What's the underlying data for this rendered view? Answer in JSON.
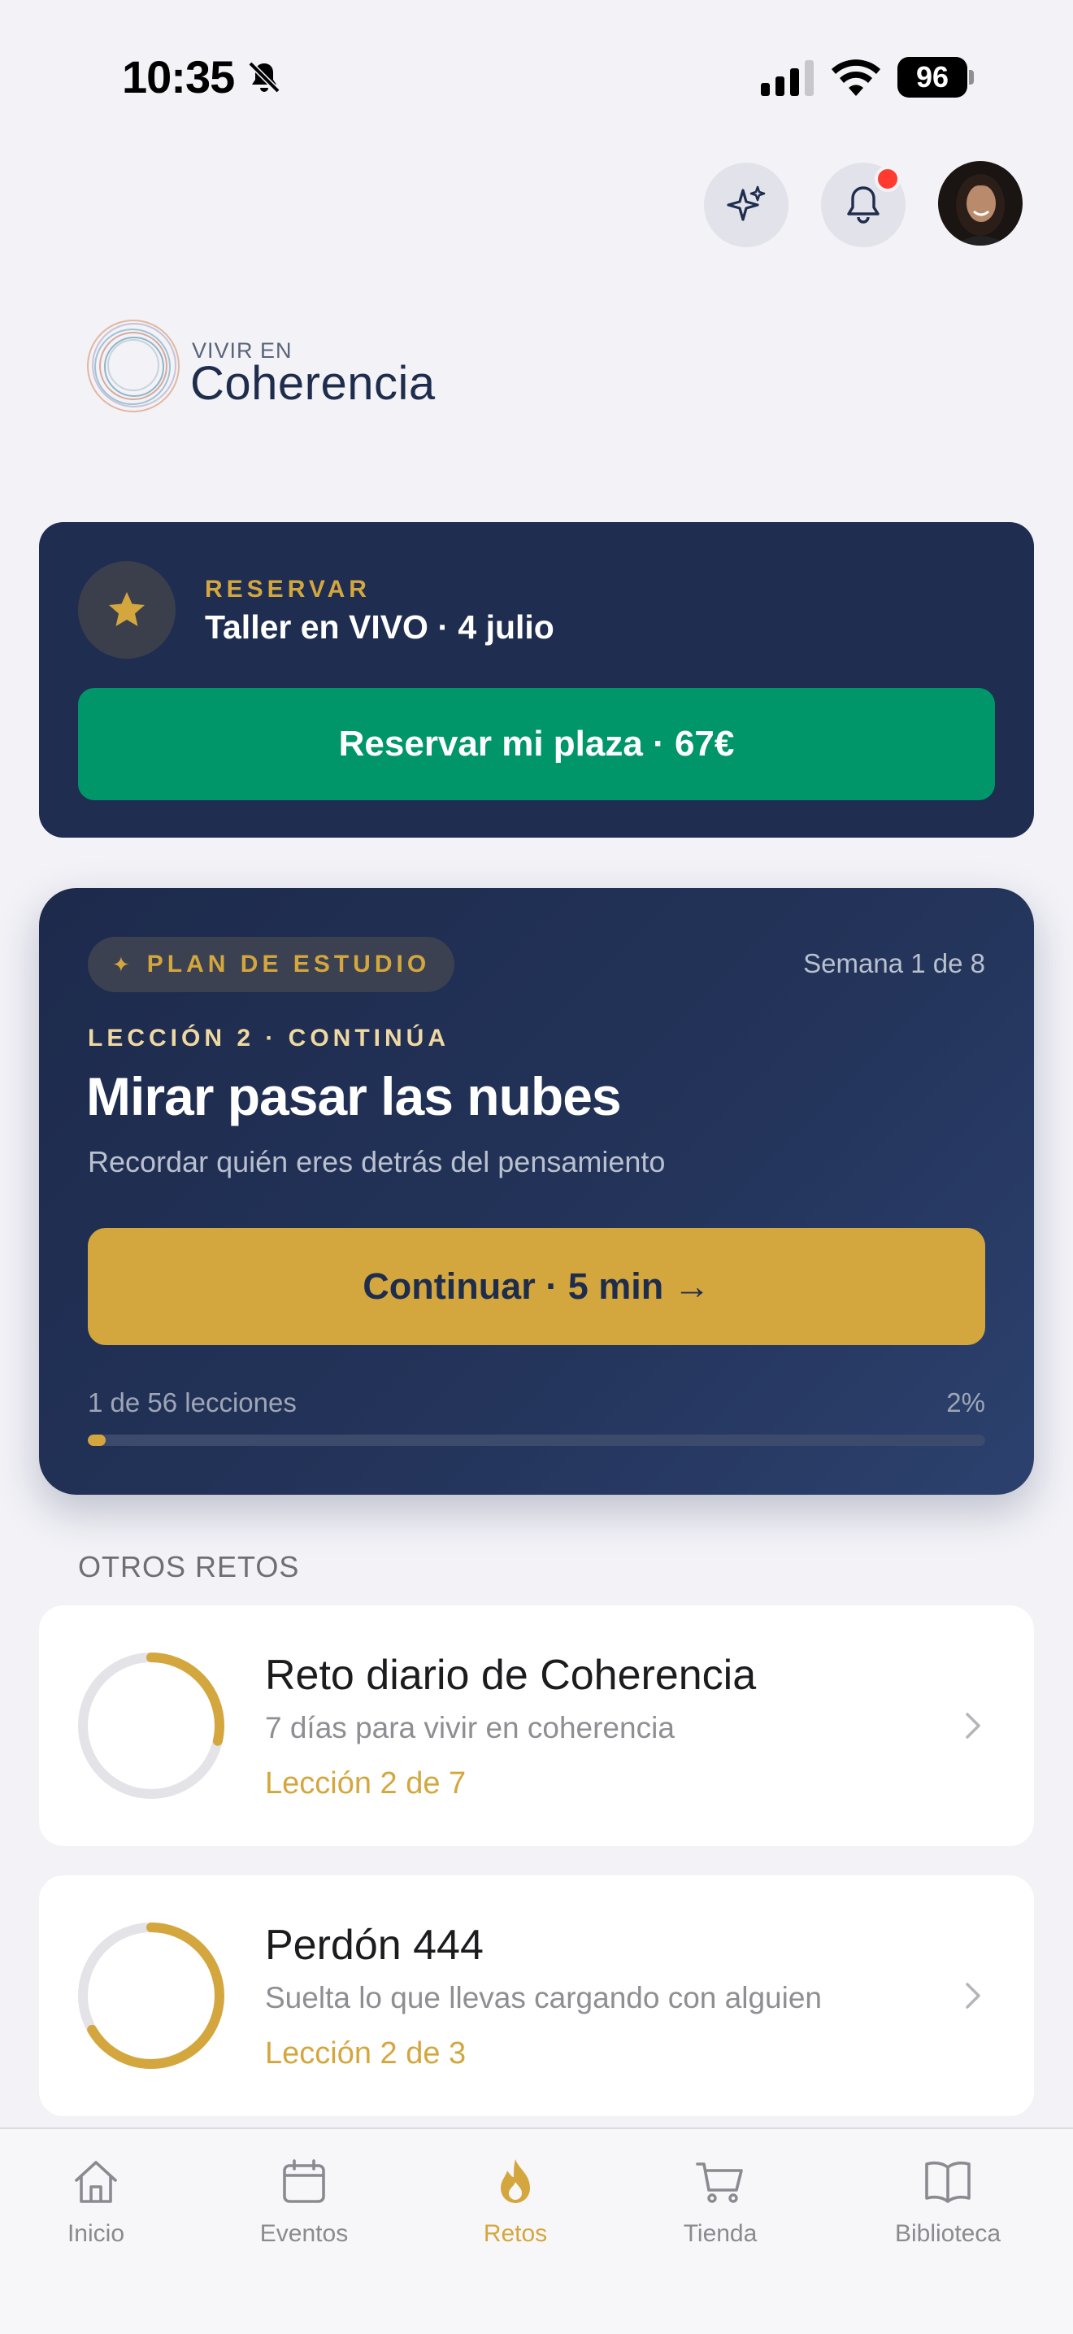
{
  "status_bar": {
    "time": "10:35",
    "battery": "96"
  },
  "logo": {
    "small": "VIVIR EN",
    "big": "Coherencia"
  },
  "reserve_card": {
    "kicker": "RESERVAR",
    "title": "Taller en VIVO · 4 julio",
    "button": "Reservar mi plaza · 67€"
  },
  "plan_card": {
    "badge": "PLAN DE ESTUDIO",
    "week": "Semana 1 de 8",
    "lesson": "LECCIÓN 2 · CONTINÚA",
    "title": "Mirar pasar las nubes",
    "subtitle": "Recordar quién eres detrás del pensamiento",
    "button": "Continuar · 5 min →",
    "count": "1 de 56 lecciones",
    "percent": "2%",
    "progress": 0.02
  },
  "section_label": "OTROS RETOS",
  "retos": [
    {
      "title": "Reto diario de Coherencia",
      "subtitle": "7 días para vivir en coherencia",
      "lesson": "Lección 2 de 7",
      "progress": 0.2857
    },
    {
      "title": "Perdón 444",
      "subtitle": "Suelta lo que llevas cargando con alguien",
      "lesson": "Lección 2 de 3",
      "progress": 0.6667
    }
  ],
  "tabs": [
    {
      "label": "Inicio",
      "icon": "home-icon"
    },
    {
      "label": "Eventos",
      "icon": "calendar-icon"
    },
    {
      "label": "Retos",
      "icon": "flame-icon",
      "active": true
    },
    {
      "label": "Tienda",
      "icon": "cart-icon"
    },
    {
      "label": "Biblioteca",
      "icon": "book-icon"
    }
  ],
  "colors": {
    "navy": "#1f2d51",
    "gold": "#d4a73e",
    "green": "#00966a",
    "badge_red": "#ff3b30"
  }
}
